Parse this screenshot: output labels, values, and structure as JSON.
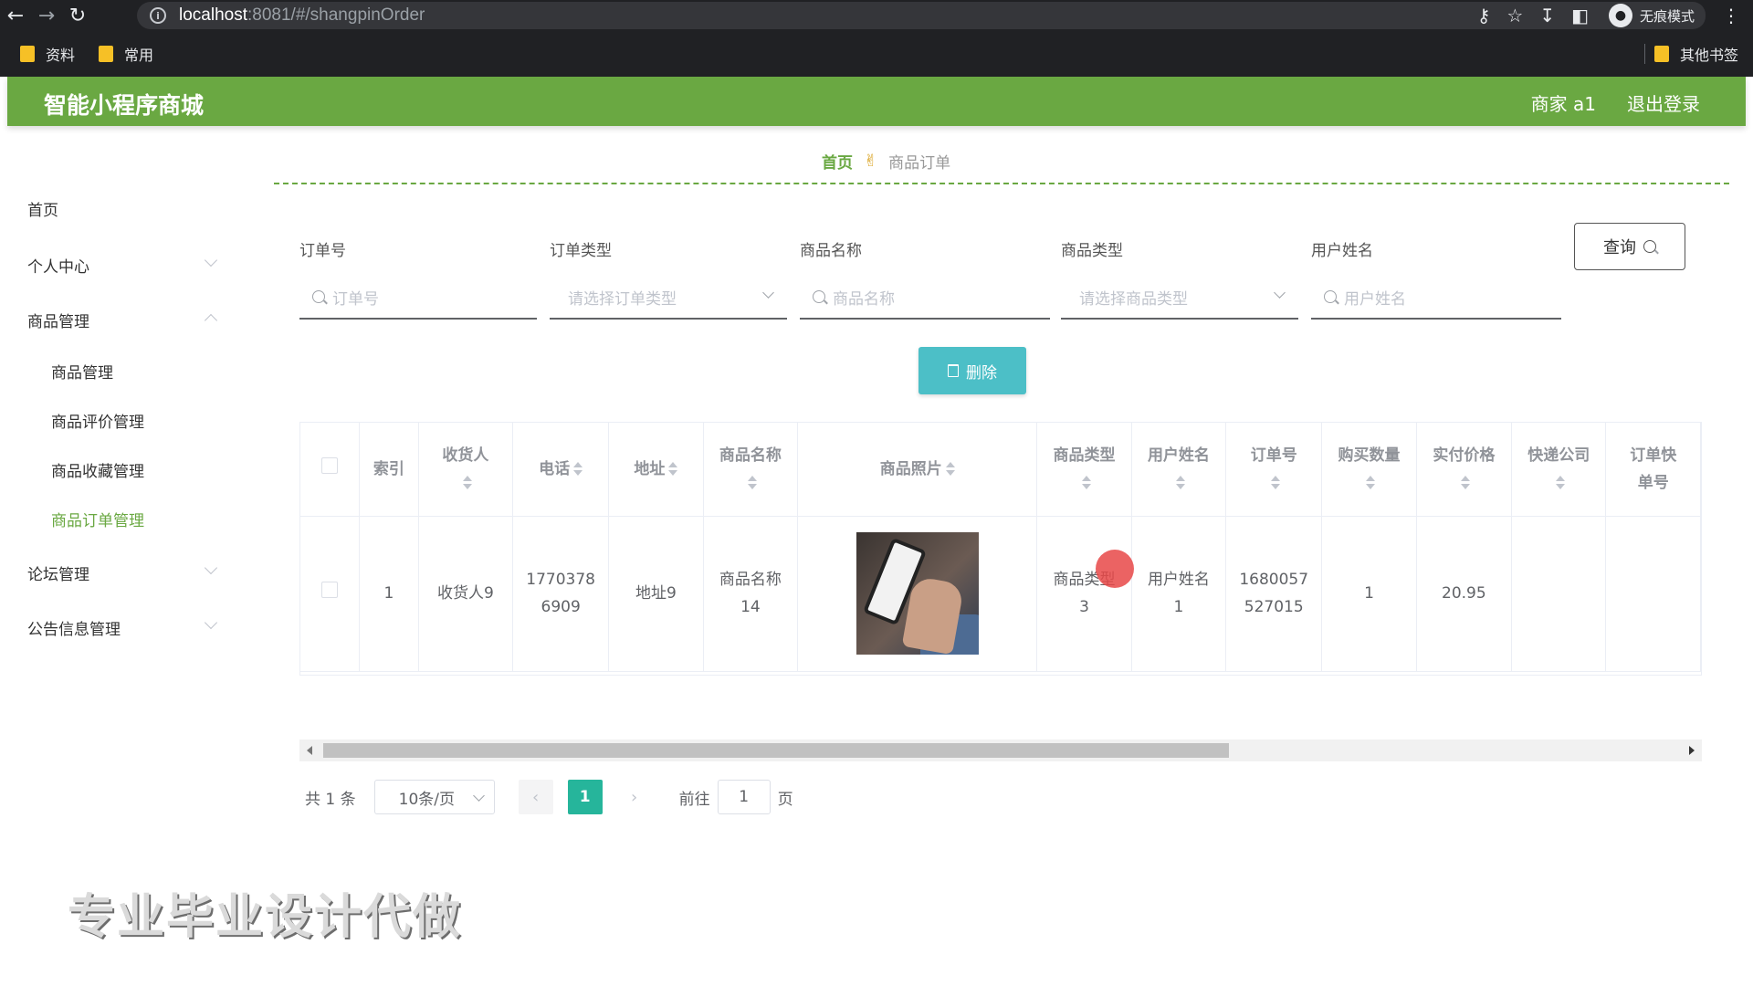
{
  "browser": {
    "url_host": "localhost",
    "url_path": ":8081/#/shangpinOrder",
    "incognito_label": "无痕模式",
    "bookmarks": [
      "资料",
      "常用"
    ],
    "other_bookmarks": "其他书签",
    "icons": [
      "back-icon",
      "forward-icon",
      "reload-icon",
      "key-icon",
      "star-icon",
      "download-icon",
      "sidepanel-icon",
      "menu-icon"
    ]
  },
  "header": {
    "title": "智能小程序商城",
    "user": "商家 a1",
    "logout": "退出登录",
    "color": "#6aa842"
  },
  "sidebar": {
    "home": "首页",
    "personal": "个人中心",
    "goods_mgmt": "商品管理",
    "sub": [
      "商品管理",
      "商品评价管理",
      "商品收藏管理",
      "商品订单管理"
    ],
    "active_sub": "商品订单管理",
    "forum": "论坛管理",
    "notice": "公告信息管理"
  },
  "breadcrumb": {
    "home": "首页",
    "current": "商品订单"
  },
  "search": {
    "fields": [
      {
        "label": "订单号",
        "placeholder": "订单号"
      },
      {
        "label": "订单类型",
        "placeholder": "请选择订单类型"
      },
      {
        "label": "商品名称",
        "placeholder": "商品名称"
      },
      {
        "label": "商品类型",
        "placeholder": "请选择商品类型"
      },
      {
        "label": "用户姓名",
        "placeholder": "用户姓名"
      }
    ],
    "query_button": "查询"
  },
  "actions": {
    "delete_button": "删除"
  },
  "table": {
    "headers": [
      "索引",
      "收货人",
      "电话",
      "地址",
      "商品名称",
      "商品照片",
      "商品类型",
      "用户姓名",
      "订单号",
      "购买数量",
      "实付价格",
      "快递公司",
      "订单快递单号"
    ],
    "header_lines": {
      "shouhuoren": "收货人",
      "shangpin_mingcheng": "商品名称",
      "shangpin_leixing": "商品类型",
      "yonghu_xingming": "用户姓名",
      "dingdanhao": "订单号",
      "goumai_shuliang": "购买数量",
      "shifu_jiage": "实付价格",
      "kuaidi_gongsi": "快递公司",
      "dingdan_kuaidi_1": "订单快",
      "dingdan_kuaidi_2": "单号"
    },
    "rows": [
      {
        "index": "1",
        "receiver": "收货人9",
        "phone_1": "1770378",
        "phone_2": "6909",
        "address": "地址9",
        "goods_name_1": "商品名称",
        "goods_name_2": "14",
        "goods_type_1": "商品类型",
        "goods_type_2": "3",
        "user_name_1": "用户姓名",
        "user_name_2": "1",
        "order_no_1": "1680057",
        "order_no_2": "527015",
        "quantity": "1",
        "price": "20.95"
      }
    ]
  },
  "pagination": {
    "total": "共 1 条",
    "page_size": "10条/页",
    "current_page": "1",
    "goto_prefix": "前往",
    "goto_value": "1",
    "goto_suffix": "页"
  },
  "watermark": "专业毕业设计代做"
}
